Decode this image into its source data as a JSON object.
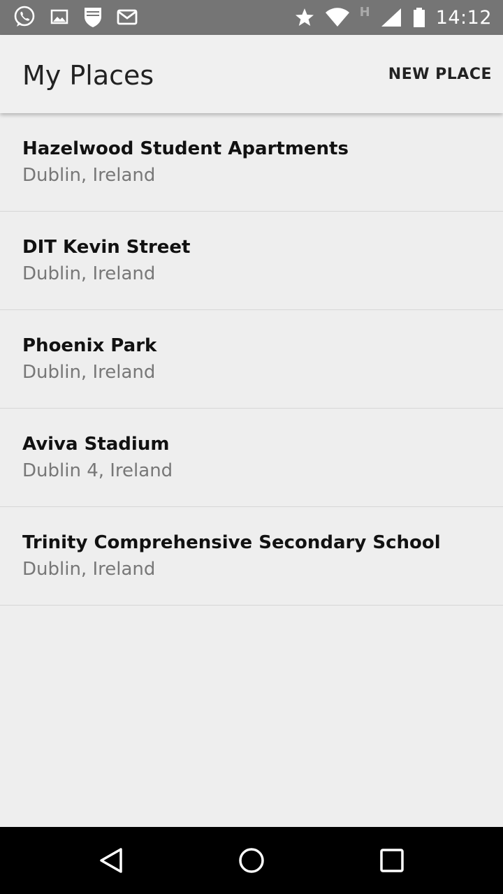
{
  "status_bar": {
    "time": "14:12",
    "left_icons": [
      "whatsapp-icon",
      "image-icon",
      "shield-icon",
      "gmail-icon"
    ],
    "right_icons": [
      "star-icon",
      "wifi-icon",
      "h-network-icon",
      "signal-icon",
      "battery-icon"
    ],
    "network_letter": "H"
  },
  "app_bar": {
    "title": "My Places",
    "action_label": "NEW PLACE"
  },
  "places": [
    {
      "name": "Hazelwood Student Apartments",
      "location": "Dublin, Ireland"
    },
    {
      "name": "DIT Kevin Street",
      "location": "Dublin, Ireland"
    },
    {
      "name": "Phoenix Park",
      "location": "Dublin, Ireland"
    },
    {
      "name": "Aviva Stadium",
      "location": "Dublin 4, Ireland"
    },
    {
      "name": "Trinity Comprehensive Secondary School",
      "location": "Dublin, Ireland"
    }
  ],
  "nav_bar": {
    "buttons": [
      "back-icon",
      "home-icon",
      "recents-icon"
    ]
  },
  "colors": {
    "status_bar": "#757575",
    "background": "#eeeeee",
    "app_bar": "#f0f0f0",
    "nav_bar": "#000000"
  }
}
